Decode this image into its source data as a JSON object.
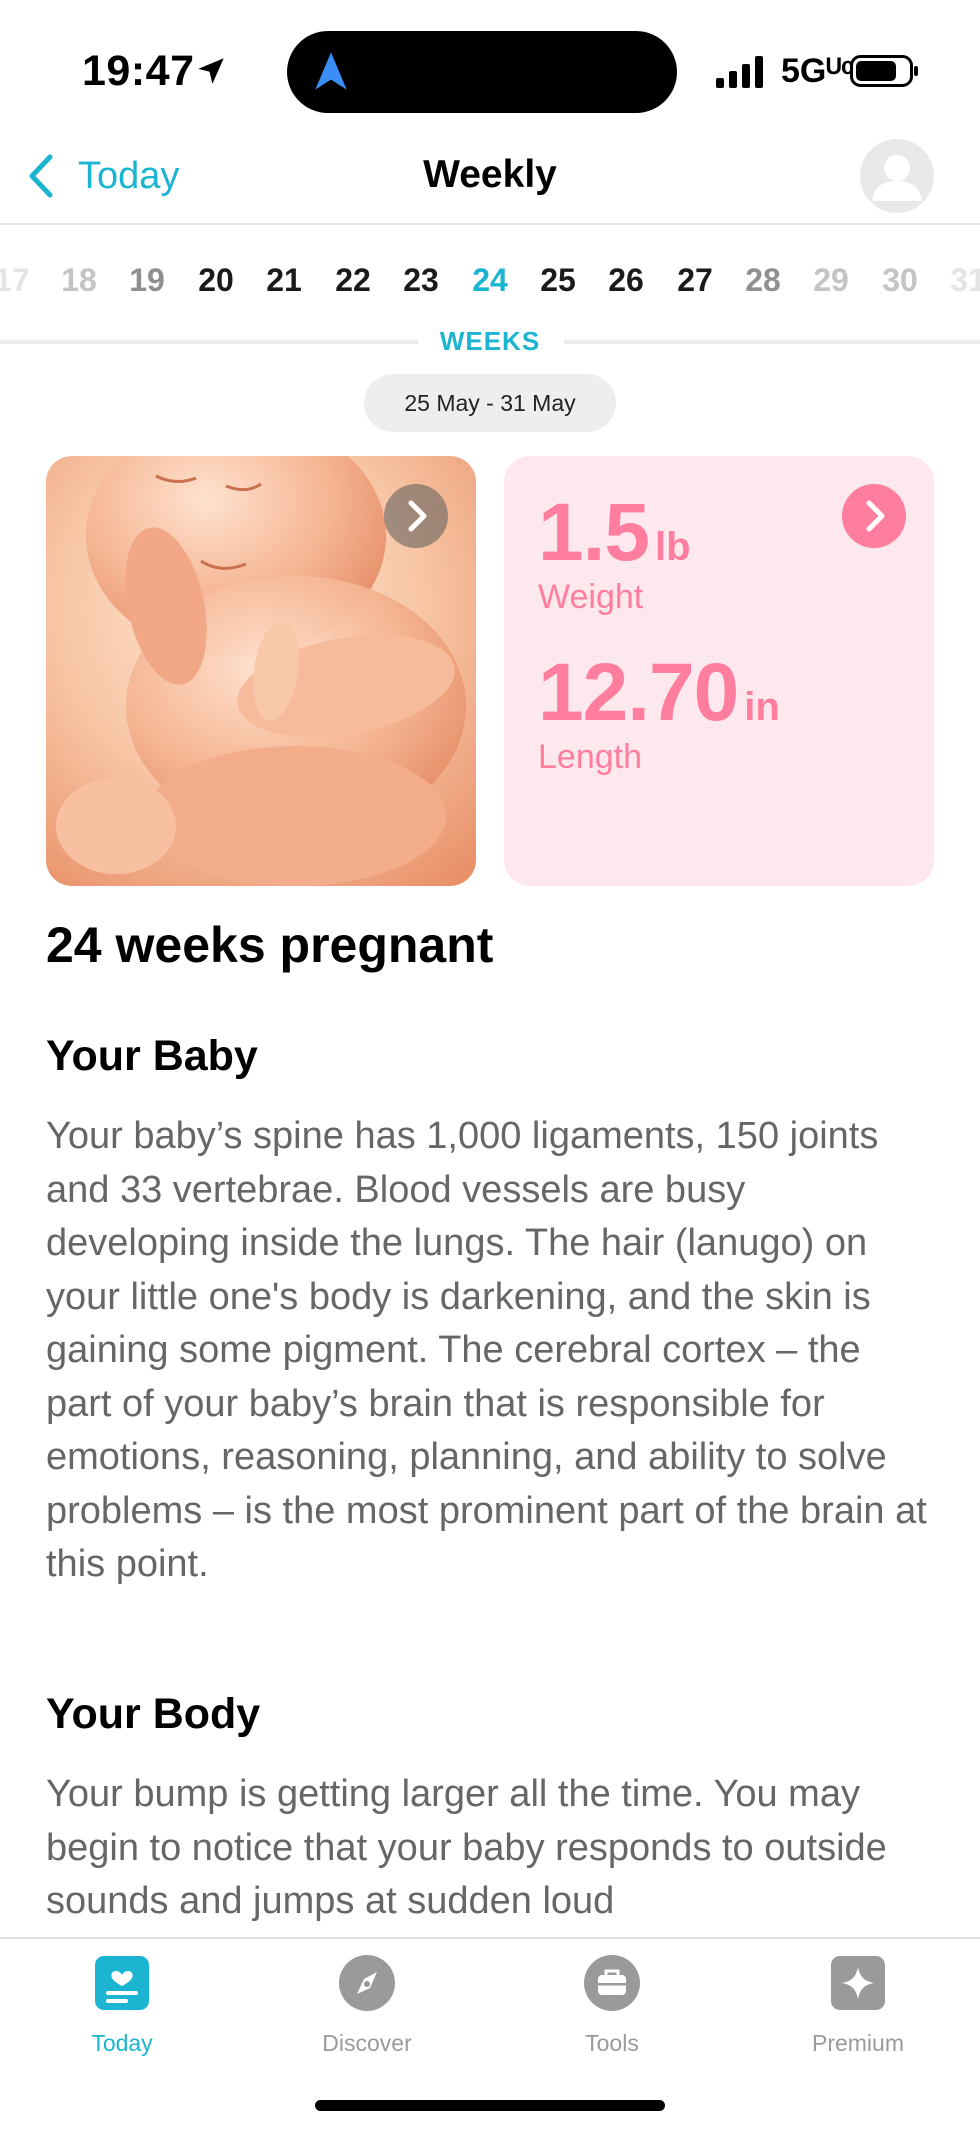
{
  "status_bar": {
    "time": "19:47",
    "network": "5Gᵁᶜ"
  },
  "header": {
    "back_label": "Today",
    "title": "Weekly"
  },
  "week_selector": {
    "weeks": [
      "17",
      "18",
      "19",
      "20",
      "21",
      "22",
      "23",
      "24",
      "25",
      "26",
      "27",
      "28",
      "29",
      "30",
      "31"
    ],
    "current_week": "24",
    "label": "WEEKS",
    "date_range": "25 May - 31 May"
  },
  "stats": {
    "weight_value": "1.5",
    "weight_unit": "lb",
    "weight_label": "Weight",
    "length_value": "12.70",
    "length_unit": "in",
    "length_label": "Length"
  },
  "article": {
    "title": "24 weeks pregnant",
    "baby_heading": "Your Baby",
    "baby_text": "Your baby’s spine has 1,000 ligaments, 150 joints and 33 vertebrae. Blood vessels are busy developing inside the lungs. The hair (lanugo) on your little one's body is darkening, and the skin is gaining some pigment. The cerebral cortex – the part of your baby’s brain that is responsible for emotions, reasoning, planning, and ability to solve problems – is the most prominent part of the brain at this point.",
    "body_heading": "Your Body",
    "body_text": "Your bump is getting larger all the time. You may begin to notice that your baby responds to outside sounds and jumps at sudden loud"
  },
  "tabs": [
    {
      "label": "Today",
      "icon": "today-icon",
      "active": true
    },
    {
      "label": "Discover",
      "icon": "compass-icon",
      "active": false
    },
    {
      "label": "Tools",
      "icon": "briefcase-icon",
      "active": false
    },
    {
      "label": "Premium",
      "icon": "sparkle-icon",
      "active": false
    }
  ],
  "colors": {
    "accent": "#1bb5d1",
    "pink": "#ff7d9e",
    "pink_bg": "#fde8ee",
    "muted_text": "#666666"
  }
}
